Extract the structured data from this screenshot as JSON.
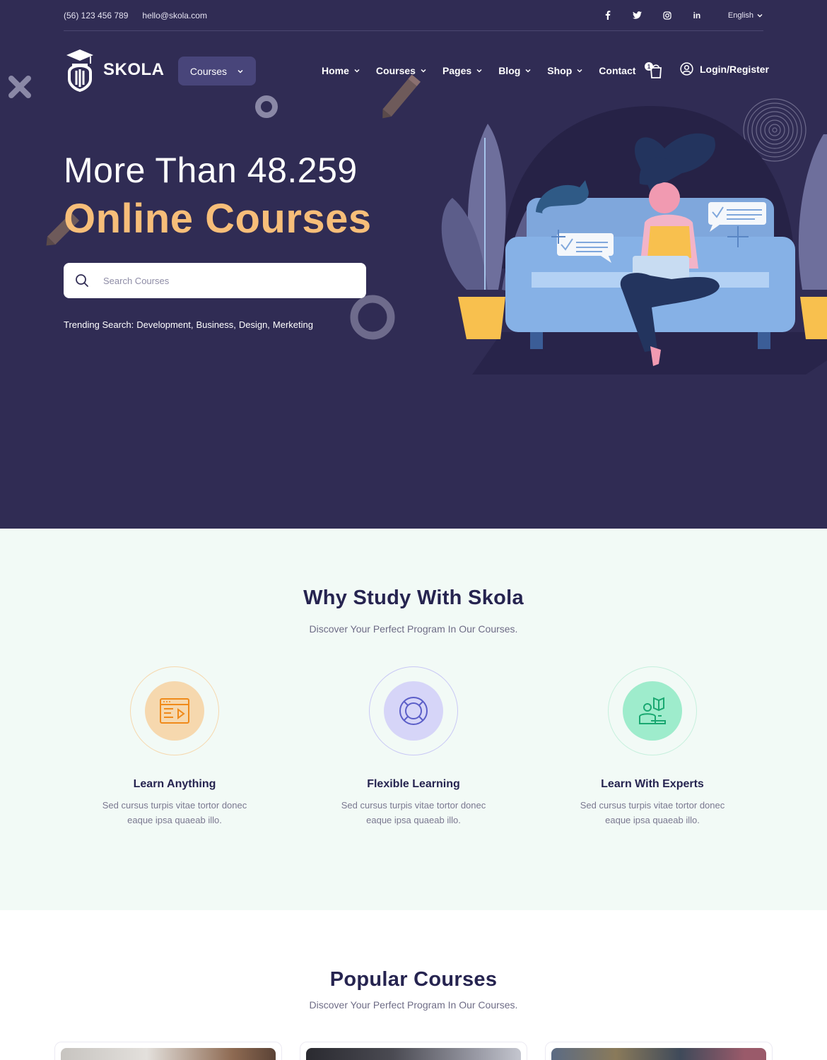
{
  "topbar": {
    "phone": "(56) 123 456 789",
    "email": "hello@skola.com",
    "socials": [
      "facebook-icon",
      "twitter-icon",
      "instagram-icon",
      "linkedin-icon"
    ],
    "language": "English"
  },
  "brand": {
    "name": "SKOLA"
  },
  "category_button": {
    "label": "Courses"
  },
  "nav": {
    "items": [
      {
        "label": "Home",
        "dropdown": true
      },
      {
        "label": "Courses",
        "dropdown": true
      },
      {
        "label": "Pages",
        "dropdown": true
      },
      {
        "label": "Blog",
        "dropdown": true
      },
      {
        "label": "Shop",
        "dropdown": true
      },
      {
        "label": "Contact",
        "dropdown": false
      }
    ],
    "cart_count": "1",
    "login_label": "Login/Register"
  },
  "hero": {
    "title_line1": "More Than 48.259",
    "title_line2": "Online Courses",
    "search_placeholder": "Search Courses",
    "trending_label": "Trending Search:",
    "trending_items": [
      "Development,",
      "Business,",
      "Design,",
      "Merketing"
    ]
  },
  "why": {
    "title": "Why Study With Skola",
    "subtitle": "Discover Your Perfect Program In Our Courses.",
    "features": [
      {
        "title": "Learn Anything",
        "desc_line1": "Sed cursus turpis vitae tortor donec",
        "desc_line2": "eaque ipsa quaeab illo.",
        "icon": "video-course-icon"
      },
      {
        "title": "Flexible Learning",
        "desc_line1": "Sed cursus turpis vitae tortor donec",
        "desc_line2": "eaque ipsa quaeab illo.",
        "icon": "lifebuoy-icon"
      },
      {
        "title": "Learn With Experts",
        "desc_line1": "Sed cursus turpis vitae tortor donec",
        "desc_line2": "eaque ipsa quaeab illo.",
        "icon": "expert-reading-icon"
      }
    ]
  },
  "popular": {
    "title": "Popular Courses",
    "subtitle": "Discover Your Perfect Program In Our Courses."
  },
  "colors": {
    "hero_bg": "#302c54",
    "accent_orange": "#f7be79",
    "why_bg": "#f2faf6",
    "feature1": "#f6d8ae",
    "feature2": "#d6d5f8",
    "feature3": "#9eeccc"
  }
}
